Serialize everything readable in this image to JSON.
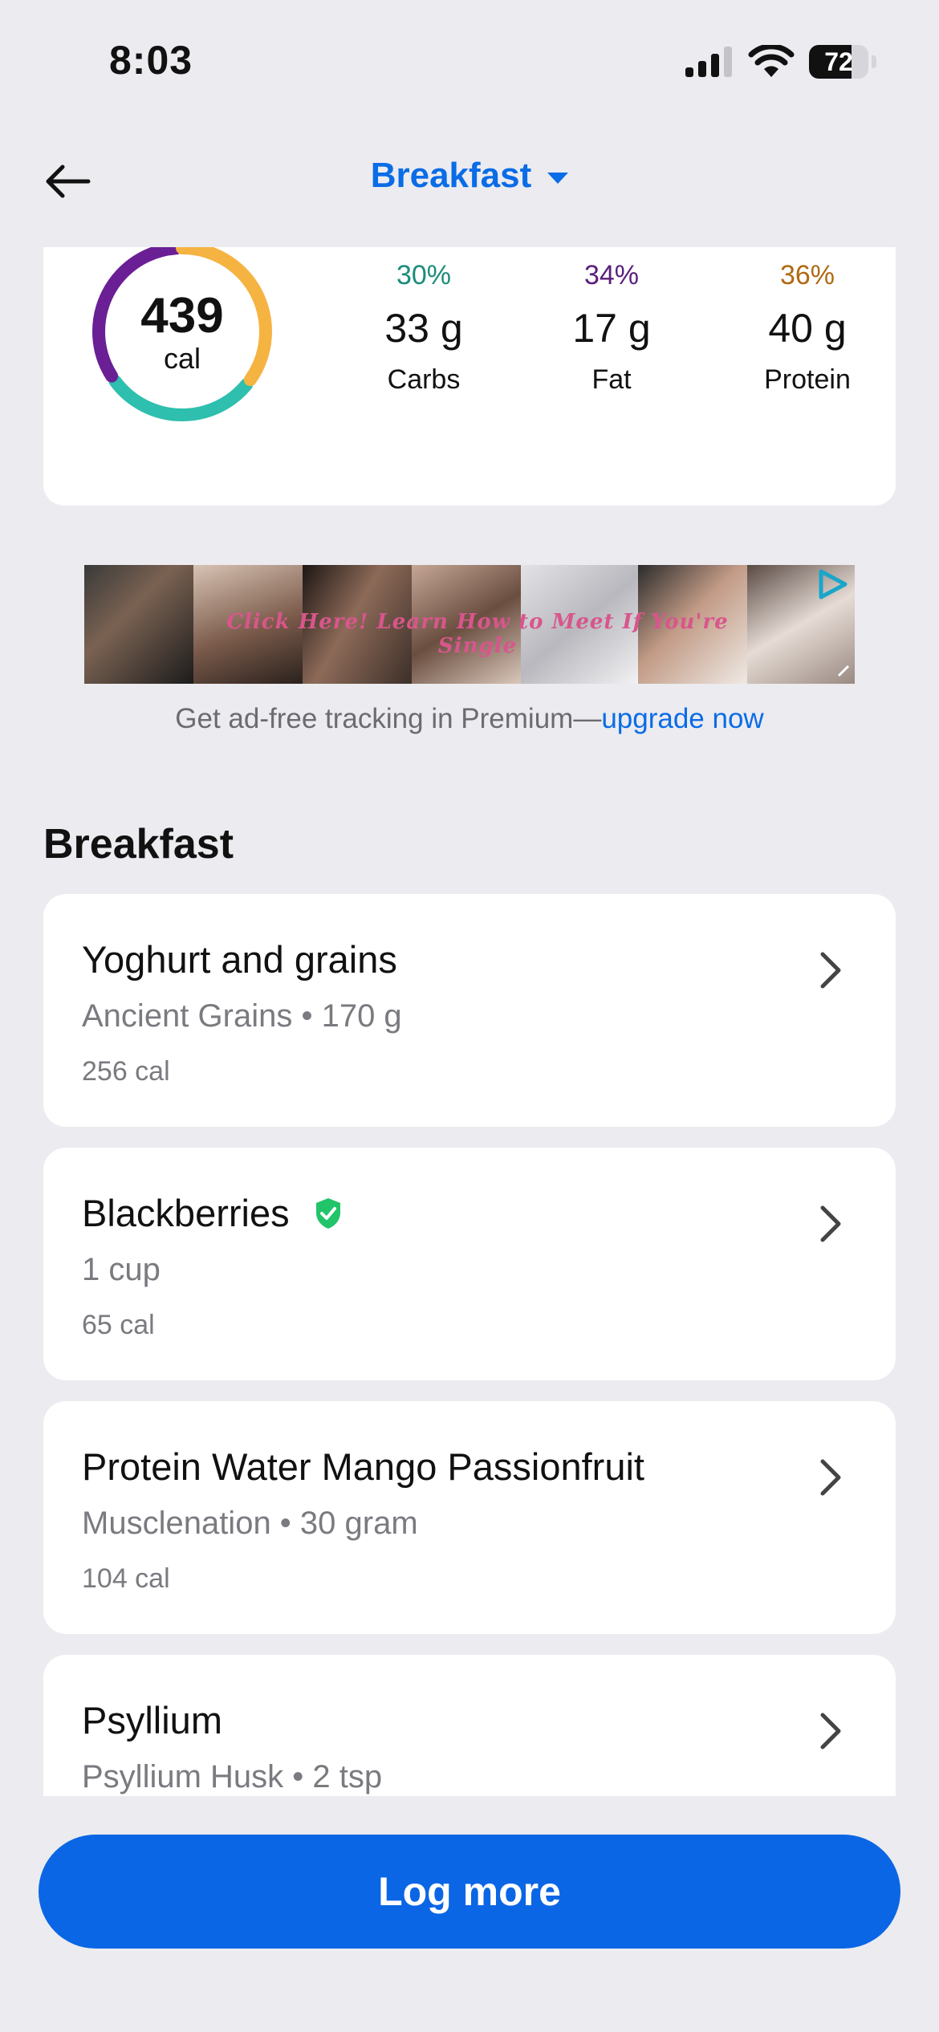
{
  "status_bar": {
    "time": "8:03",
    "battery": "72",
    "battery_level": 0.72
  },
  "header": {
    "title": "Breakfast"
  },
  "summary": {
    "calories": "439",
    "calories_unit": "cal",
    "macros": [
      {
        "pct": "30%",
        "amount": "33 g",
        "name": "Carbs",
        "color": "#1b8c7b"
      },
      {
        "pct": "34%",
        "amount": "17 g",
        "name": "Fat",
        "color": "#5b1e7e"
      },
      {
        "pct": "36%",
        "amount": "40 g",
        "name": "Protein",
        "color": "#b06a13"
      }
    ],
    "ring_colors": {
      "carbs": "#2ebfae",
      "fat": "#6a1f95",
      "protein": "#f5b342"
    }
  },
  "ad": {
    "banner_text": "Click Here! Learn How to Meet If You're Single",
    "premium_text": "Get ad-free tracking in Premium—",
    "premium_link": "upgrade now"
  },
  "section": {
    "title": "Breakfast"
  },
  "foods": [
    {
      "name": "Yoghurt and grains",
      "detail": "Ancient Grains • 170 g",
      "calories": "256 cal",
      "verified": false
    },
    {
      "name": "Blackberries",
      "detail": "1 cup",
      "calories": "65 cal",
      "verified": true
    },
    {
      "name": "Protein Water Mango Passionfruit",
      "detail": "Musclenation • 30 gram",
      "calories": "104 cal",
      "verified": false
    },
    {
      "name": "Psyllium",
      "detail": "Psyllium Husk • 2 tsp",
      "calories": "",
      "verified": false
    }
  ],
  "actions": {
    "log_more": "Log more"
  },
  "colors": {
    "accent": "#0a6ce6",
    "background": "#ebebf0",
    "verified": "#22c46a"
  }
}
